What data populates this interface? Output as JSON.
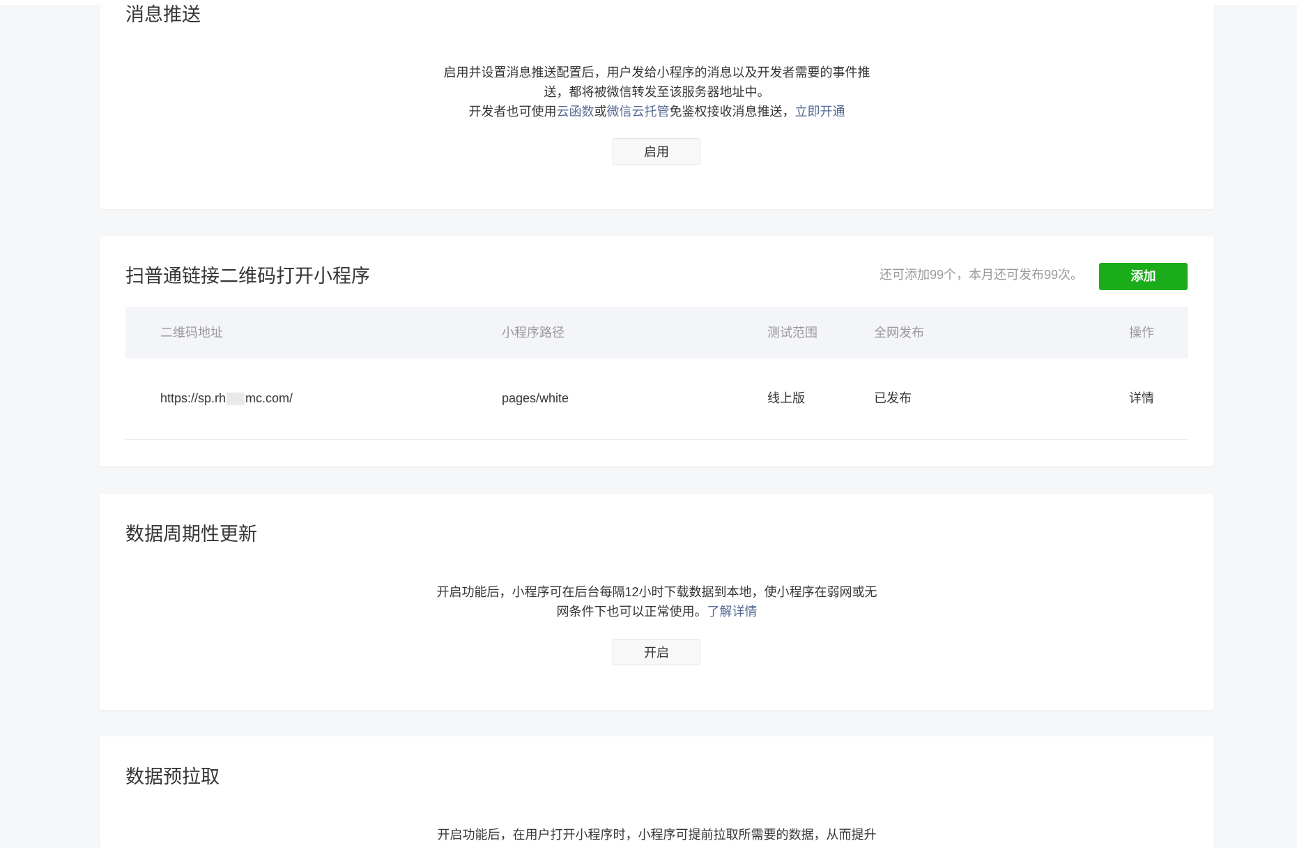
{
  "msg_push": {
    "title": "消息推送",
    "desc_line1": "启用并设置消息推送配置后，用户发给小程序的消息以及开发者需要的事件推",
    "desc_line2": "送，都将被微信转发至该服务器地址中。",
    "desc_line3_prefix": "开发者也可使用",
    "link_cloud_function": "云函数",
    "desc_or": "或",
    "link_cloud_hosting": "微信云托管",
    "desc_line3_suffix": "免鉴权接收消息推送，",
    "link_enable_now": "立即开通",
    "enable_button": "启用"
  },
  "qr_open": {
    "title": "扫普通链接二维码打开小程序",
    "quota_text": "还可添加99个，本月还可发布99次。",
    "add_button": "添加",
    "columns": [
      "二维码地址",
      "小程序路径",
      "测试范围",
      "全网发布",
      "操作"
    ],
    "rows": [
      {
        "url_prefix": "https://sp.rh",
        "url_suffix": "mc.com/",
        "path": "pages/white",
        "test_scope": "线上版",
        "publish": "已发布",
        "action": "详情"
      }
    ]
  },
  "periodic_update": {
    "title": "数据周期性更新",
    "desc_line1": "开启功能后，小程序可在后台每隔12小时下载数据到本地，使小程序在弱网或无",
    "desc_line2_prefix": "网条件下也可以正常使用。",
    "link_learn_more": "了解详情",
    "enable_button": "开启"
  },
  "prefetch": {
    "title": "数据预拉取",
    "desc_line1": "开启功能后，在用户打开小程序时，小程序可提前拉取所需要的数据，从而提升"
  },
  "colors": {
    "page_bg": "#f6f7f9",
    "link": "#576b95",
    "primary": "#1aad19",
    "muted_text": "#9a9a9a"
  }
}
